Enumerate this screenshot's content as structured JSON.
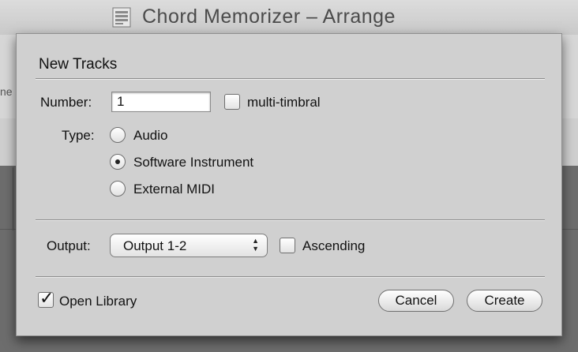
{
  "window": {
    "title": "Chord Memorizer – Arrange",
    "partial_text": "ne"
  },
  "dialog": {
    "title": "New Tracks",
    "number_label": "Number:",
    "number_value": "1",
    "multi_timbral_label": "multi-timbral",
    "multi_timbral_checked": false,
    "type_label": "Type:",
    "type_options": [
      {
        "label": "Audio",
        "selected": false
      },
      {
        "label": "Software Instrument",
        "selected": true
      },
      {
        "label": "External MIDI",
        "selected": false
      }
    ],
    "output_label": "Output:",
    "output_value": "Output 1-2",
    "ascending_label": "Ascending",
    "ascending_checked": false,
    "open_library_label": "Open Library",
    "open_library_checked": true,
    "cancel_label": "Cancel",
    "create_label": "Create"
  }
}
